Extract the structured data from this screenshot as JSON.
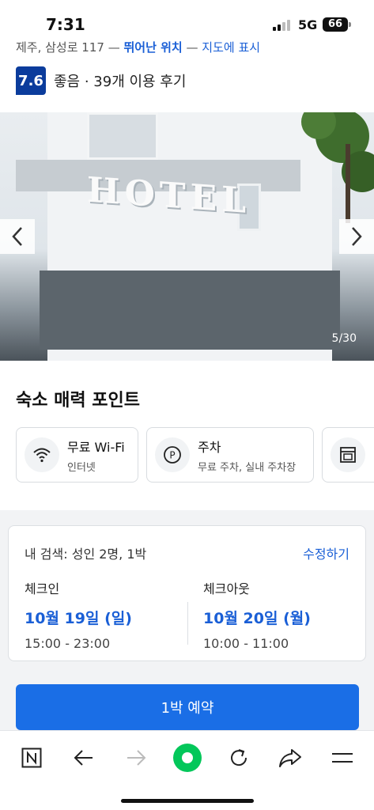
{
  "status_bar": {
    "time": "7:31",
    "network": "5G",
    "battery": "66"
  },
  "hotel": {
    "address_prefix": "제주, 삼성로 117",
    "location_badge": "뛰어난 위치",
    "map_link": "지도에 표시",
    "score": "7.6",
    "rating_summary": "좋음 · 39개 이용 후기"
  },
  "gallery": {
    "counter": "5/30",
    "prev_icon": "chevron-left-icon",
    "next_icon": "chevron-right-icon"
  },
  "highlights": {
    "title": "숙소 매력 포인트",
    "items": [
      {
        "icon": "wifi-icon",
        "title": "무료 Wi-Fi",
        "subtitle": "인터넷"
      },
      {
        "icon": "parking-icon",
        "title": "주차",
        "subtitle": "무료 주차, 실내 주차장"
      },
      {
        "icon": "appliance-icon",
        "title": "",
        "subtitle": ""
      }
    ]
  },
  "search": {
    "summary": "내 검색: 성인 2명, 1박",
    "edit_label": "수정하기",
    "checkin": {
      "label": "체크인",
      "date": "10월 19일 (일)",
      "time": "15:00 - 23:00"
    },
    "checkout": {
      "label": "체크아웃",
      "date": "10월 20일 (월)",
      "time": "10:00 - 11:00"
    }
  },
  "cta": {
    "book_label": "1박 예약",
    "color": "#1a6ee6"
  },
  "browser_toolbar": {
    "items": [
      "naver-home-icon",
      "back-arrow-icon",
      "forward-arrow-icon",
      "green-dot-icon",
      "reload-icon",
      "share-icon",
      "menu-icon"
    ]
  },
  "colors": {
    "accent": "#1a5fd6",
    "score_bg": "#0b3c9c",
    "green": "#03c75a"
  }
}
